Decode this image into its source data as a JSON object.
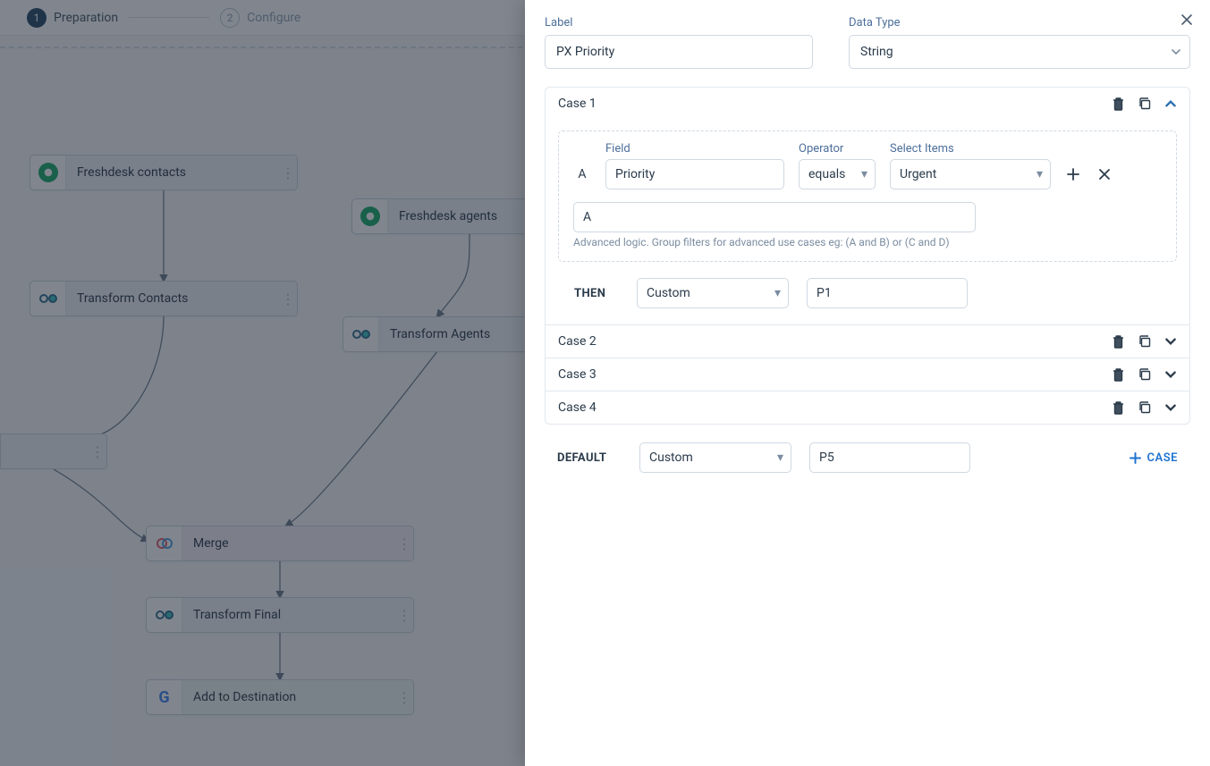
{
  "stepper": {
    "steps": [
      {
        "num": "1",
        "label": "Preparation"
      },
      {
        "num": "2",
        "label": "Configure"
      }
    ]
  },
  "nodes": {
    "fresh_contacts": "Freshdesk contacts",
    "fresh_agents": "Freshdesk agents",
    "transform_contacts": "Transform Contacts",
    "transform_agents": "Transform Agents",
    "merge": "Merge",
    "transform_final": "Transform Final",
    "add_dest": "Add to Destination"
  },
  "panel": {
    "label_field_label": "Label",
    "label_field_value": "PX Priority",
    "type_field_label": "Data Type",
    "type_field_value": "String",
    "case_expanded": {
      "title": "Case 1",
      "rule": {
        "letter": "A",
        "field_label": "Field",
        "field_value": "Priority",
        "op_label": "Operator",
        "op_value": "equals",
        "sel_label": "Select Items",
        "sel_value": "Urgent"
      },
      "adv_value": "A",
      "adv_help": "Advanced logic. Group filters for advanced use cases eg: (A and B) or (C and D)",
      "then_label": "THEN",
      "then_type": "Custom",
      "then_value": "P1"
    },
    "cases_collapsed": [
      "Case 2",
      "Case 3",
      "Case 4"
    ],
    "default_label": "DEFAULT",
    "default_type": "Custom",
    "default_value": "P5",
    "add_case_label": "CASE"
  }
}
